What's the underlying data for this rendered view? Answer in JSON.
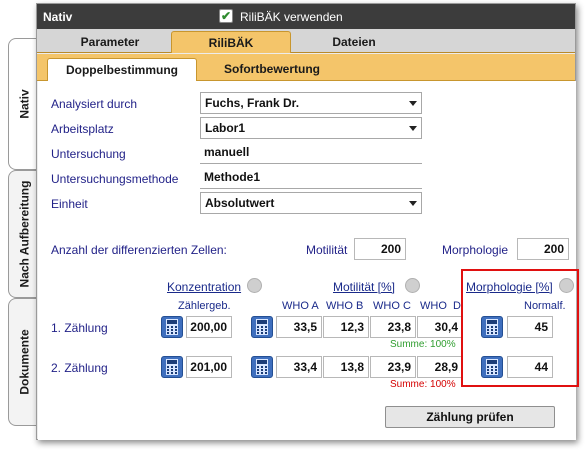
{
  "side_tabs": {
    "nativ": "Nativ",
    "nach_aufbereitung": "Nach Aufbereitung",
    "dokumente": "Dokumente"
  },
  "window": {
    "title": "Nativ",
    "rilibak_checkbox_label": "RiliBÄK verwenden",
    "rilibak_checked": true
  },
  "main_tabs": [
    {
      "label": "Parameter"
    },
    {
      "label": "RiliBÄK",
      "active": true
    },
    {
      "label": "Dateien"
    }
  ],
  "sub_tabs": [
    {
      "label": "Doppelbestimmung",
      "active": true
    },
    {
      "label": "Sofortbewertung"
    }
  ],
  "form": {
    "analysiert_durch": {
      "label": "Analysiert durch",
      "value": "Fuchs, Frank Dr."
    },
    "arbeitsplatz": {
      "label": "Arbeitsplatz",
      "value": "Labor1"
    },
    "untersuchung": {
      "label": "Untersuchung",
      "value": "manuell"
    },
    "untersuchungsmethode": {
      "label": "Untersuchungsmethode",
      "value": "Methode1"
    },
    "einheit": {
      "label": "Einheit",
      "value": "Absolutwert"
    }
  },
  "cells": {
    "label": "Anzahl der differenzierten Zellen:",
    "motilitaet_label": "Motilität",
    "motilitaet_value": "200",
    "morphologie_label": "Morphologie",
    "morphologie_value": "200"
  },
  "sections": {
    "konzentration": "Konzentration",
    "motilitaet": "Motilität [%]",
    "morphologie": "Morphologie [%]"
  },
  "columns": {
    "zaehlergeb": "Zählergeb.",
    "who_a": "WHO A",
    "who_b": "WHO B",
    "who_c": "WHO C",
    "who_d": "WHO  D",
    "normalf": "Normalf."
  },
  "rows": [
    {
      "label": "1. Zählung",
      "zaehlergeb": "200,00",
      "who_a": "33,5",
      "who_b": "12,3",
      "who_c": "23,8",
      "who_d": "30,4",
      "summe": "Summe: 100%",
      "normalf": "45"
    },
    {
      "label": "2. Zählung",
      "zaehlergeb": "201,00",
      "who_a": "33,4",
      "who_b": "13,8",
      "who_c": "23,9",
      "who_d": "28,9",
      "summe": "Summe: 100%",
      "normalf": "44"
    }
  ],
  "buttons": {
    "zaehlung_pruefen": "Zählung prüfen"
  },
  "colors": {
    "titlebar": "#3c3c3c",
    "tab_active_orange": "#f4c56a",
    "label_blue": "#222288",
    "calc_blue": "#3f6fbe",
    "summe_ok_green": "#2f9d2f",
    "summe_error_red": "#d40000",
    "highlight_red": "#e01010",
    "status_led_gray": "#cfcfcf"
  },
  "icons": {
    "calculator": "calculator-icon",
    "status": "status-led-icon",
    "dropdown": "chevron-down-icon",
    "checkbox": "checkmark-icon"
  }
}
